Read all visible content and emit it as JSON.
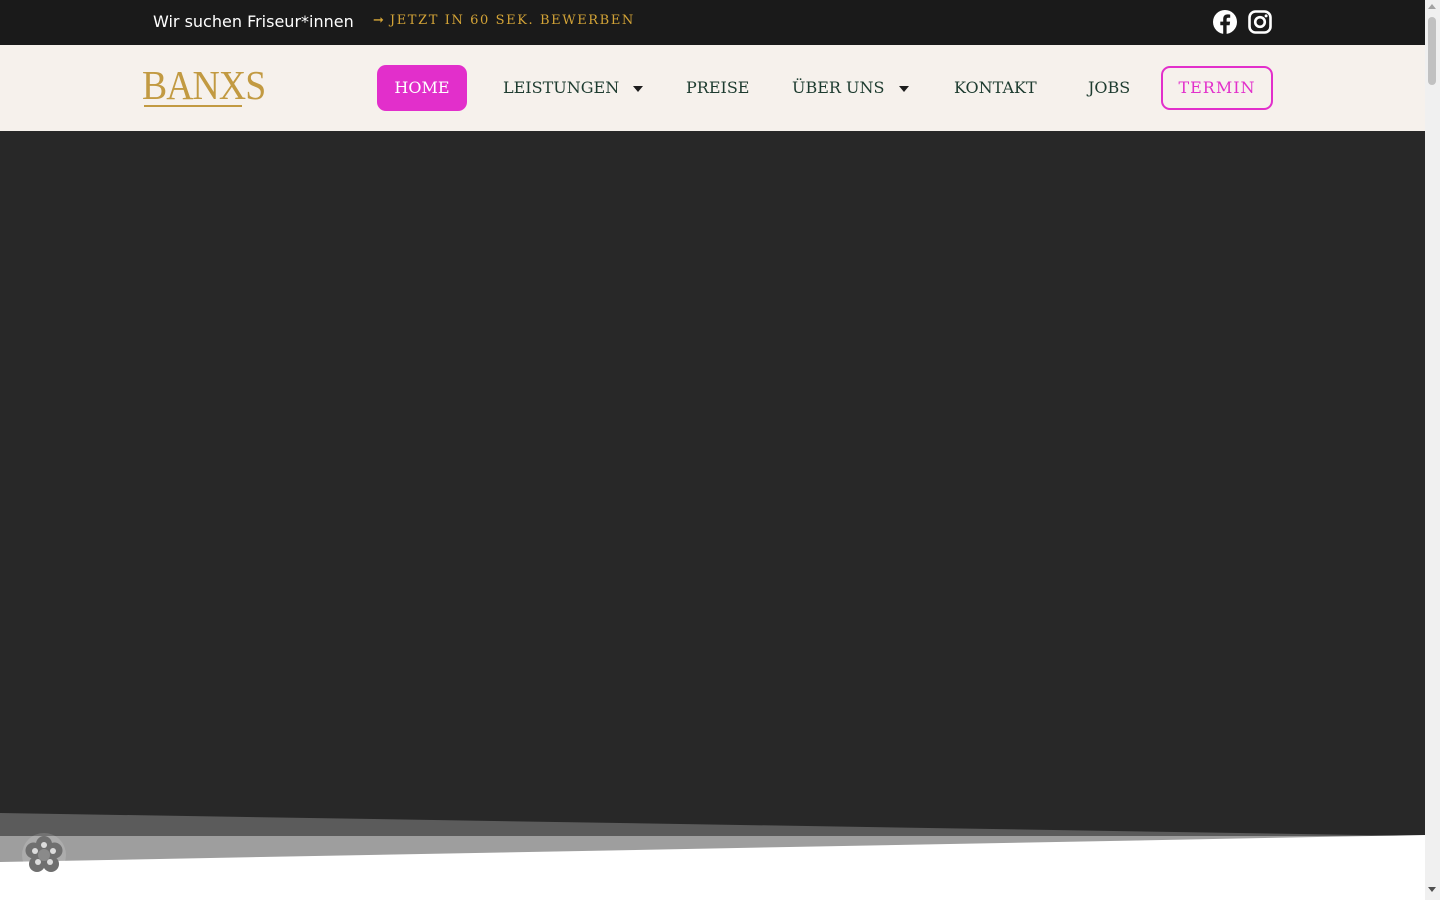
{
  "topbar": {
    "hiring_text": "Wir suchen Friseur*innen",
    "apply_arrow": "➞",
    "apply_label": "JETZT IN 60 SEK. BEWERBEN",
    "social": [
      "facebook-icon",
      "instagram-icon"
    ]
  },
  "header": {
    "logo_text": "BANXS",
    "nav": {
      "home": "HOME",
      "leistungen": "LEISTUNGEN",
      "preise": "PREISE",
      "ueber_uns": "ÜBER UNS",
      "kontakt": "KONTAKT",
      "jobs": "JOBS"
    },
    "termin_label": "TERMIN",
    "active_item": "HOME"
  },
  "colors": {
    "topbar_bg": "#1a1a1a",
    "header_bg": "#f6f1ec",
    "accent_pink": "#e22fcb",
    "gold": "#c29a42",
    "apply_gold": "#d4a437",
    "nav_text": "#1d3b2f",
    "hero_bg": "#282828"
  }
}
